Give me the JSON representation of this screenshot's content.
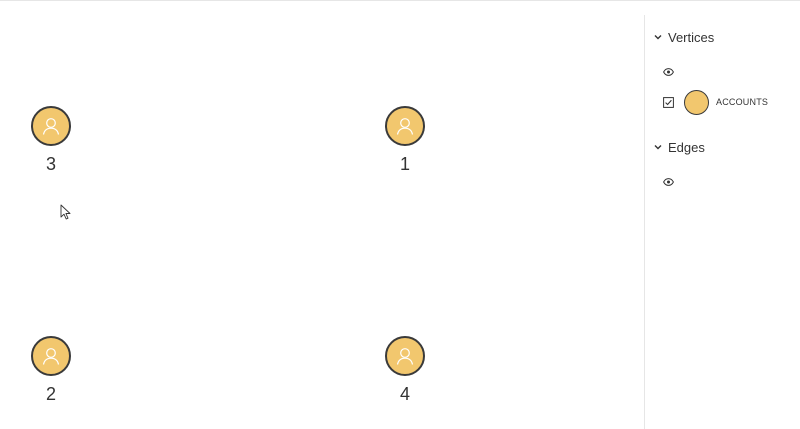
{
  "graph": {
    "nodes": [
      {
        "id": "n3",
        "label": "3"
      },
      {
        "id": "n1",
        "label": "1"
      },
      {
        "id": "n2",
        "label": "2"
      },
      {
        "id": "n4",
        "label": "4"
      }
    ],
    "node_icon": "user-icon"
  },
  "panel": {
    "vertices": {
      "title": "Vertices",
      "visibility_icon": "eye-icon",
      "items": [
        {
          "label": "ACCOUNTS",
          "checked": true
        }
      ]
    },
    "edges": {
      "title": "Edges",
      "visibility_icon": "eye-icon"
    }
  },
  "colors": {
    "node_fill": "#f2c76e",
    "node_stroke": "#3a3a3a",
    "divider": "#e6e6e6"
  }
}
